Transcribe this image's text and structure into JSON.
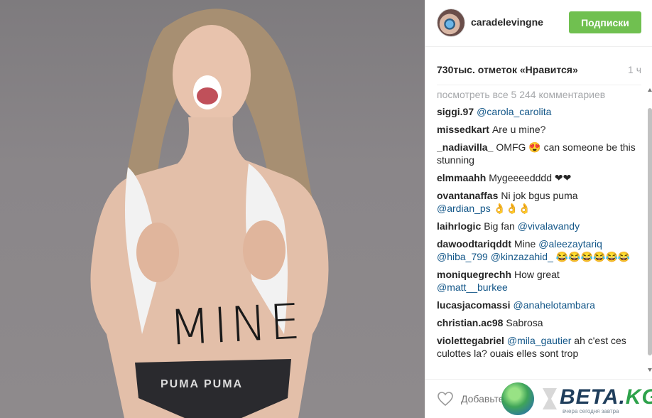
{
  "photo": {
    "body_text": "MINE",
    "band_text": "PUMA  PUMA"
  },
  "header": {
    "username": "caradelevingne",
    "follow_label": "Подписки",
    "follow_color": "#70c050"
  },
  "likes": {
    "text": "730тыс. отметок «Нравится»",
    "time": "1 ч"
  },
  "comments": {
    "load_more": "посмотреть все 5 244 комментариев",
    "items": [
      {
        "user": "siggi.97",
        "text": "",
        "mention": "@carola_carolita"
      },
      {
        "user": "missedkart",
        "text": "Are u mine?"
      },
      {
        "user": "_nadiavilla_",
        "text": "OMFG 😍 can someone be this stunning"
      },
      {
        "user": "elmmaahh",
        "text": "Mygeeeedddd ❤❤"
      },
      {
        "user": "ovantanaffas",
        "text": "Ni jok bgus puma",
        "mention": "@ardian_ps",
        "tail": " 👌👌👌"
      },
      {
        "user": "laihrlogic",
        "text": "Big fan",
        "mention": "@vivalavandy"
      },
      {
        "user": "dawoodtariqddt",
        "text": "Mine",
        "mention": "@aleezaytariq @hiba_799 @kinzazahid_",
        "tail": " 😂😂😂😂😂😂"
      },
      {
        "user": "moniquegrechh",
        "text": "How great",
        "mention": "@matt__burkee"
      },
      {
        "user": "lucasjacomassi",
        "text": "",
        "mention": "@anahelotambara"
      },
      {
        "user": "christian.ac98",
        "text": "Sabrosa"
      },
      {
        "user": "violettegabriel",
        "text": "",
        "mention": "@mila_gautier",
        "tail": " ah c'est ces culottes la? ouais elles sont trop"
      }
    ]
  },
  "footer": {
    "comment_placeholder": "Добавьте"
  },
  "watermark": {
    "brand_main": "BETA.",
    "brand_accent": "KG",
    "tagline": "вчера сегодня завтра"
  }
}
